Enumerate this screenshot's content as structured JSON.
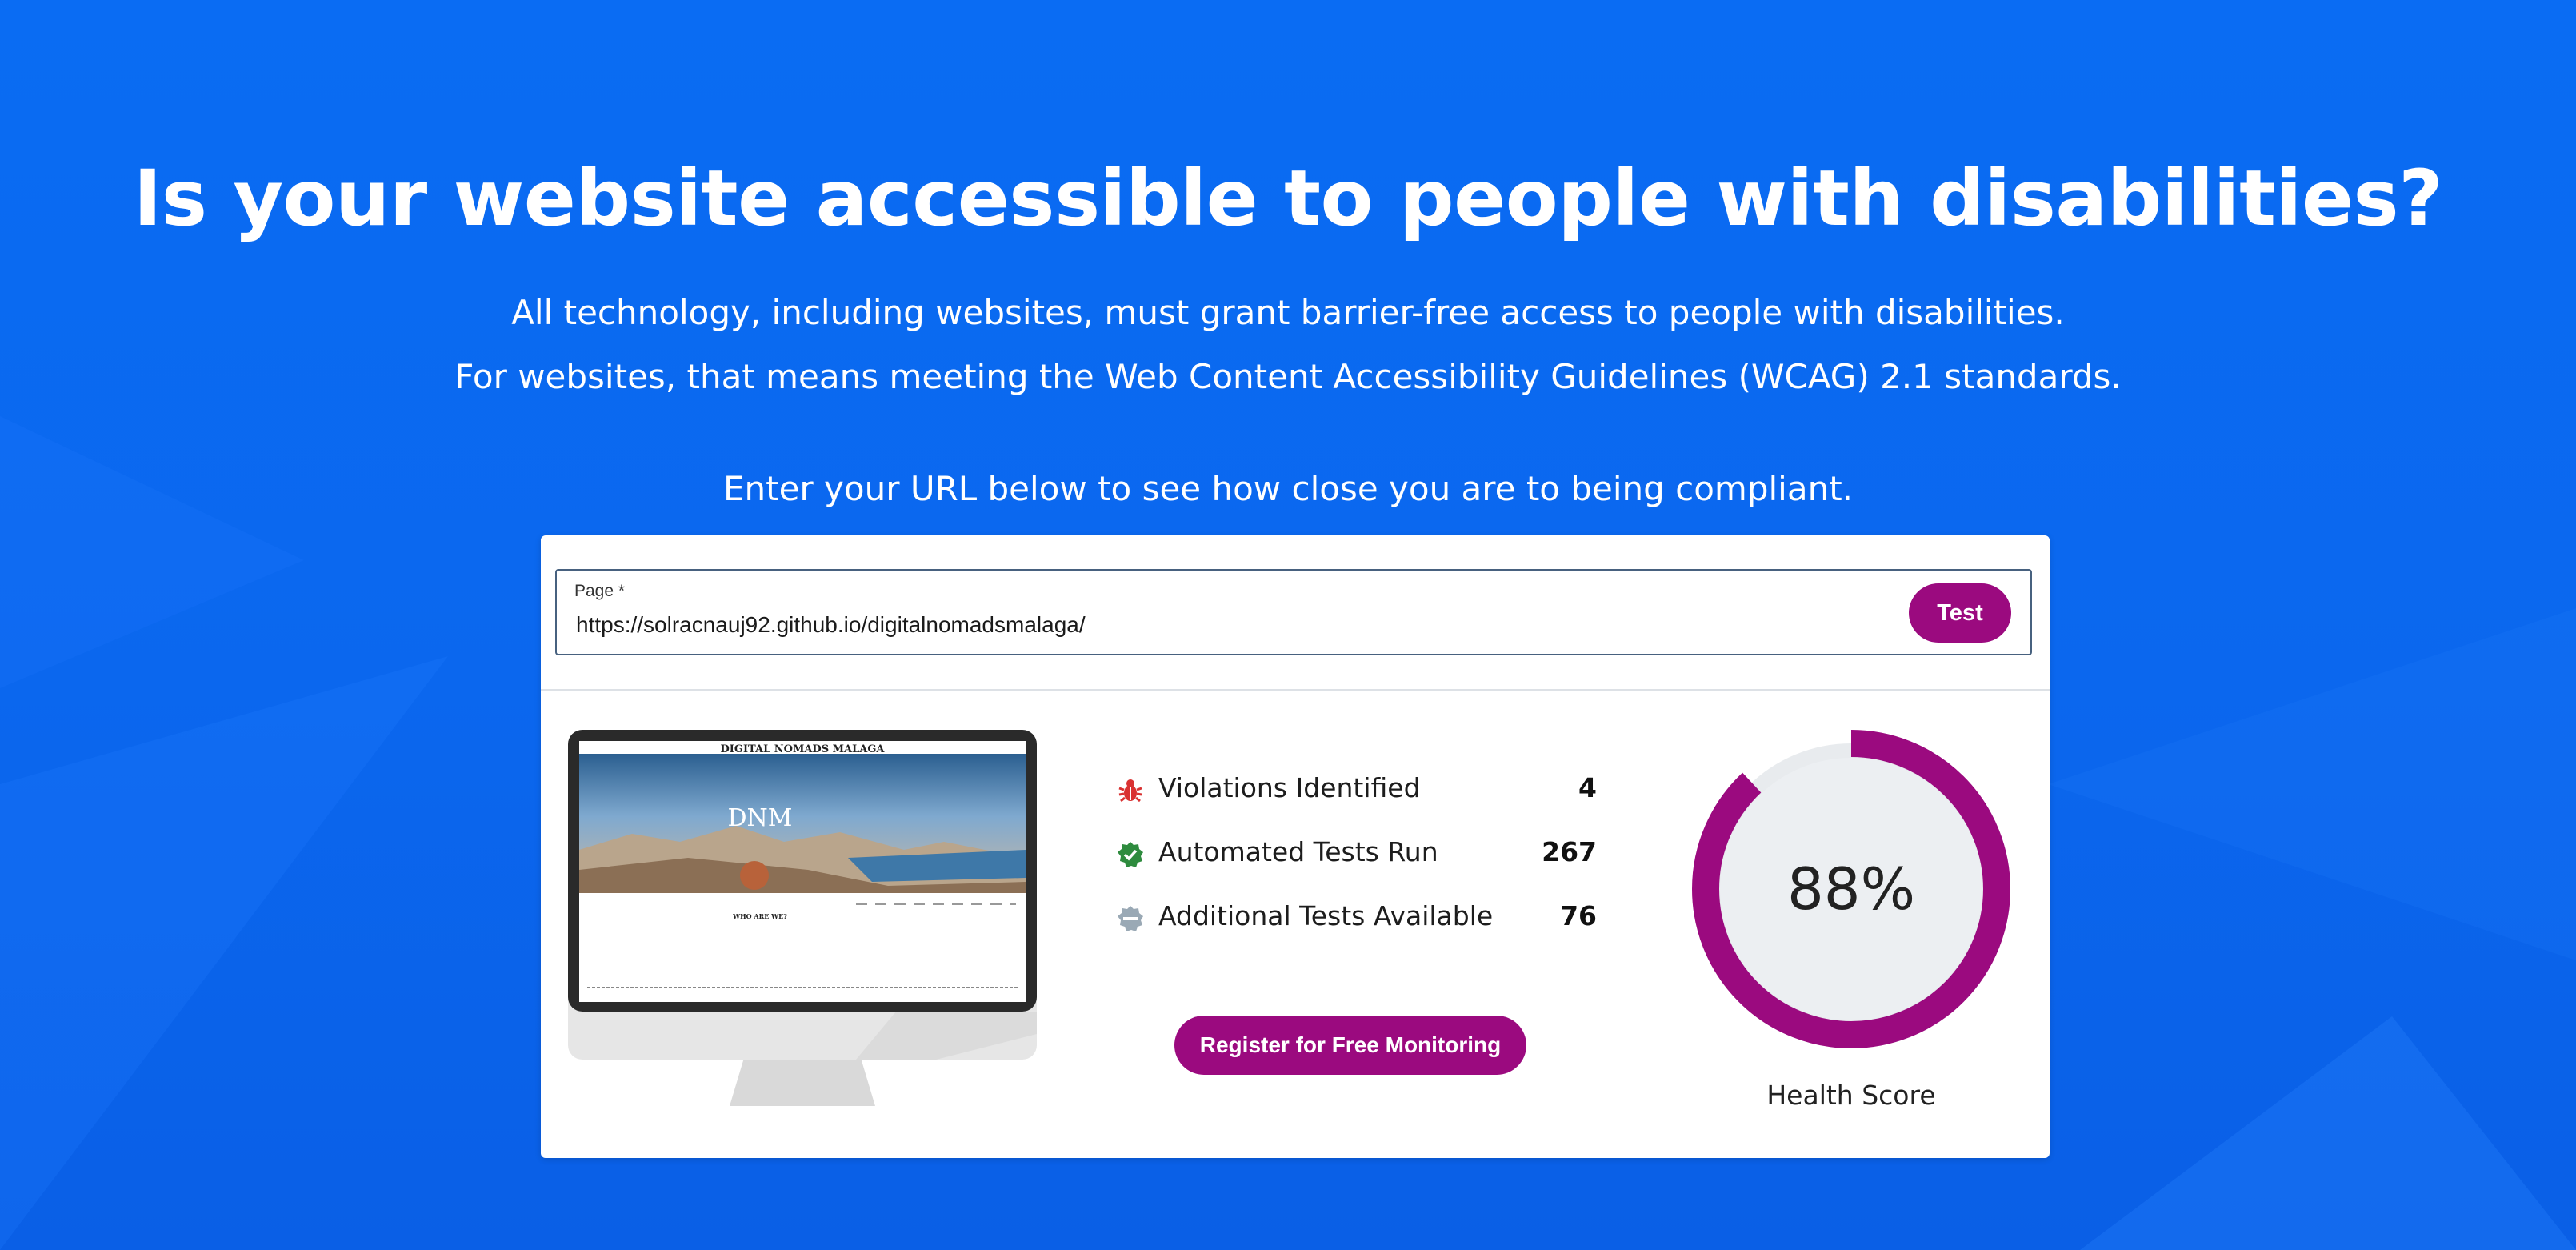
{
  "hero": {
    "headline": "Is your website accessible to people with disabilities?",
    "line1": "All technology, including websites, must grant barrier-free access to people with disabilities.",
    "line2": "For websites, that means meeting the Web Content Accessibility Guidelines (WCAG) 2.1 standards.",
    "line3": "Enter your URL below to see how close you are to being compliant."
  },
  "form": {
    "field_label": "Page *",
    "url_value": "https://solracnauj92.github.io/digitalnomadsmalaga/",
    "test_button": "Test"
  },
  "preview": {
    "site_title": "DIGITAL NOMADS MALAGA",
    "logo_text": "DNM",
    "section_heading": "WHO ARE WE?"
  },
  "stats": [
    {
      "label": "Violations Identified",
      "value": "4",
      "icon": "bug-icon",
      "color": "#d93232"
    },
    {
      "label": "Automated Tests Run",
      "value": "267",
      "icon": "check-badge-icon",
      "color": "#2e8b3e"
    },
    {
      "label": "Additional Tests Available",
      "value": "76",
      "icon": "minus-badge-icon",
      "color": "#9aa9b5"
    }
  ],
  "register_button": "Register for Free Monitoring",
  "health": {
    "score": 0.88,
    "score_text": "88%",
    "caption": "Health Score"
  },
  "colors": {
    "background": "#0b67ee",
    "accent": "#9b0a7f",
    "gauge_track": "#e8ebee"
  }
}
